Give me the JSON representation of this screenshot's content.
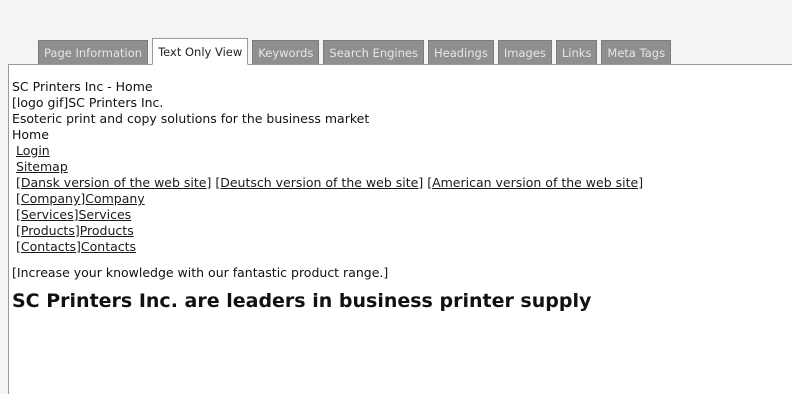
{
  "tabs": [
    {
      "label": "Page Information",
      "active": false
    },
    {
      "label": "Text Only View",
      "active": true
    },
    {
      "label": "Keywords",
      "active": false
    },
    {
      "label": "Search Engines",
      "active": false
    },
    {
      "label": "Headings",
      "active": false
    },
    {
      "label": "Images",
      "active": false
    },
    {
      "label": "Links",
      "active": false
    },
    {
      "label": "Meta Tags",
      "active": false
    }
  ],
  "content": {
    "title": "SC Printers Inc - Home",
    "logo_line": "[logo gif]SC Printers Inc.",
    "tagline": "Esoteric print and copy solutions for the business market",
    "home": "Home",
    "login": "Login",
    "sitemap": "Sitemap",
    "lang_dansk": "[Dansk version of the web site]",
    "lang_deutsch": "[Deutsch version of the web site]",
    "lang_american": "[American version of the web site]",
    "nav_company": "[Company]Company",
    "nav_services": "[Services]Services",
    "nav_products": "[Products]Products",
    "nav_contacts": "[Contacts]Contacts",
    "banner": "[Increase your knowledge with our fantastic product range.]",
    "heading": "SC Printers Inc. are leaders in business printer supply"
  }
}
